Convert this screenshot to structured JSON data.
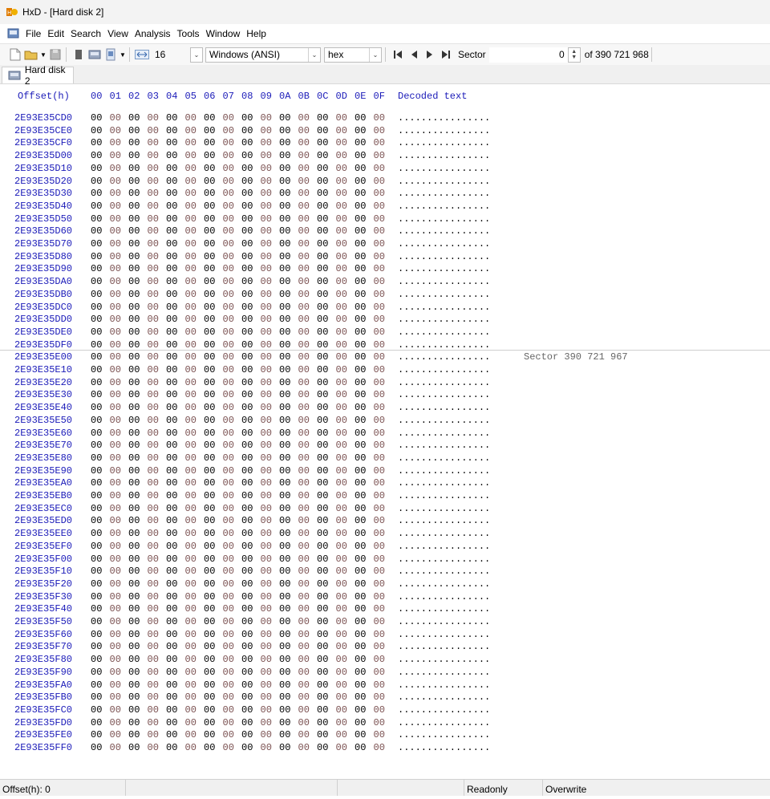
{
  "window": {
    "title": "HxD - [Hard disk 2]"
  },
  "menu": [
    "File",
    "Edit",
    "Search",
    "View",
    "Analysis",
    "Tools",
    "Window",
    "Help"
  ],
  "toolbar": {
    "bytes_per_row": "16",
    "charset": "Windows (ANSI)",
    "offset_base": "hex",
    "nav_unit": "Sector",
    "sector_value": "0",
    "sector_total": "of 390 721 968"
  },
  "tab": {
    "label": "Hard disk 2"
  },
  "editor": {
    "offset_header": "Offset(h)",
    "columns": [
      "00",
      "01",
      "02",
      "03",
      "04",
      "05",
      "06",
      "07",
      "08",
      "09",
      "0A",
      "0B",
      "0C",
      "0D",
      "0E",
      "0F"
    ],
    "decoded_header": "Decoded text",
    "rows": [
      {
        "offset": "2E93E35CD0",
        "bytes": "00 00 00 00 00 00 00 00 00 00 00 00 00 00 00 00",
        "text": "................"
      },
      {
        "offset": "2E93E35CE0",
        "bytes": "00 00 00 00 00 00 00 00 00 00 00 00 00 00 00 00",
        "text": "................"
      },
      {
        "offset": "2E93E35CF0",
        "bytes": "00 00 00 00 00 00 00 00 00 00 00 00 00 00 00 00",
        "text": "................"
      },
      {
        "offset": "2E93E35D00",
        "bytes": "00 00 00 00 00 00 00 00 00 00 00 00 00 00 00 00",
        "text": "................"
      },
      {
        "offset": "2E93E35D10",
        "bytes": "00 00 00 00 00 00 00 00 00 00 00 00 00 00 00 00",
        "text": "................"
      },
      {
        "offset": "2E93E35D20",
        "bytes": "00 00 00 00 00 00 00 00 00 00 00 00 00 00 00 00",
        "text": "................"
      },
      {
        "offset": "2E93E35D30",
        "bytes": "00 00 00 00 00 00 00 00 00 00 00 00 00 00 00 00",
        "text": "................"
      },
      {
        "offset": "2E93E35D40",
        "bytes": "00 00 00 00 00 00 00 00 00 00 00 00 00 00 00 00",
        "text": "................"
      },
      {
        "offset": "2E93E35D50",
        "bytes": "00 00 00 00 00 00 00 00 00 00 00 00 00 00 00 00",
        "text": "................"
      },
      {
        "offset": "2E93E35D60",
        "bytes": "00 00 00 00 00 00 00 00 00 00 00 00 00 00 00 00",
        "text": "................"
      },
      {
        "offset": "2E93E35D70",
        "bytes": "00 00 00 00 00 00 00 00 00 00 00 00 00 00 00 00",
        "text": "................"
      },
      {
        "offset": "2E93E35D80",
        "bytes": "00 00 00 00 00 00 00 00 00 00 00 00 00 00 00 00",
        "text": "................"
      },
      {
        "offset": "2E93E35D90",
        "bytes": "00 00 00 00 00 00 00 00 00 00 00 00 00 00 00 00",
        "text": "................"
      },
      {
        "offset": "2E93E35DA0",
        "bytes": "00 00 00 00 00 00 00 00 00 00 00 00 00 00 00 00",
        "text": "................"
      },
      {
        "offset": "2E93E35DB0",
        "bytes": "00 00 00 00 00 00 00 00 00 00 00 00 00 00 00 00",
        "text": "................"
      },
      {
        "offset": "2E93E35DC0",
        "bytes": "00 00 00 00 00 00 00 00 00 00 00 00 00 00 00 00",
        "text": "................"
      },
      {
        "offset": "2E93E35DD0",
        "bytes": "00 00 00 00 00 00 00 00 00 00 00 00 00 00 00 00",
        "text": "................"
      },
      {
        "offset": "2E93E35DE0",
        "bytes": "00 00 00 00 00 00 00 00 00 00 00 00 00 00 00 00",
        "text": "................"
      },
      {
        "offset": "2E93E35DF0",
        "bytes": "00 00 00 00 00 00 00 00 00 00 00 00 00 00 00 00",
        "text": "................"
      },
      {
        "offset": "2E93E35E00",
        "bytes": "00 00 00 00 00 00 00 00 00 00 00 00 00 00 00 00",
        "text": "................",
        "sector": "Sector 390 721 967"
      },
      {
        "offset": "2E93E35E10",
        "bytes": "00 00 00 00 00 00 00 00 00 00 00 00 00 00 00 00",
        "text": "................"
      },
      {
        "offset": "2E93E35E20",
        "bytes": "00 00 00 00 00 00 00 00 00 00 00 00 00 00 00 00",
        "text": "................"
      },
      {
        "offset": "2E93E35E30",
        "bytes": "00 00 00 00 00 00 00 00 00 00 00 00 00 00 00 00",
        "text": "................"
      },
      {
        "offset": "2E93E35E40",
        "bytes": "00 00 00 00 00 00 00 00 00 00 00 00 00 00 00 00",
        "text": "................"
      },
      {
        "offset": "2E93E35E50",
        "bytes": "00 00 00 00 00 00 00 00 00 00 00 00 00 00 00 00",
        "text": "................"
      },
      {
        "offset": "2E93E35E60",
        "bytes": "00 00 00 00 00 00 00 00 00 00 00 00 00 00 00 00",
        "text": "................"
      },
      {
        "offset": "2E93E35E70",
        "bytes": "00 00 00 00 00 00 00 00 00 00 00 00 00 00 00 00",
        "text": "................"
      },
      {
        "offset": "2E93E35E80",
        "bytes": "00 00 00 00 00 00 00 00 00 00 00 00 00 00 00 00",
        "text": "................"
      },
      {
        "offset": "2E93E35E90",
        "bytes": "00 00 00 00 00 00 00 00 00 00 00 00 00 00 00 00",
        "text": "................"
      },
      {
        "offset": "2E93E35EA0",
        "bytes": "00 00 00 00 00 00 00 00 00 00 00 00 00 00 00 00",
        "text": "................"
      },
      {
        "offset": "2E93E35EB0",
        "bytes": "00 00 00 00 00 00 00 00 00 00 00 00 00 00 00 00",
        "text": "................"
      },
      {
        "offset": "2E93E35EC0",
        "bytes": "00 00 00 00 00 00 00 00 00 00 00 00 00 00 00 00",
        "text": "................"
      },
      {
        "offset": "2E93E35ED0",
        "bytes": "00 00 00 00 00 00 00 00 00 00 00 00 00 00 00 00",
        "text": "................"
      },
      {
        "offset": "2E93E35EE0",
        "bytes": "00 00 00 00 00 00 00 00 00 00 00 00 00 00 00 00",
        "text": "................"
      },
      {
        "offset": "2E93E35EF0",
        "bytes": "00 00 00 00 00 00 00 00 00 00 00 00 00 00 00 00",
        "text": "................"
      },
      {
        "offset": "2E93E35F00",
        "bytes": "00 00 00 00 00 00 00 00 00 00 00 00 00 00 00 00",
        "text": "................"
      },
      {
        "offset": "2E93E35F10",
        "bytes": "00 00 00 00 00 00 00 00 00 00 00 00 00 00 00 00",
        "text": "................"
      },
      {
        "offset": "2E93E35F20",
        "bytes": "00 00 00 00 00 00 00 00 00 00 00 00 00 00 00 00",
        "text": "................"
      },
      {
        "offset": "2E93E35F30",
        "bytes": "00 00 00 00 00 00 00 00 00 00 00 00 00 00 00 00",
        "text": "................"
      },
      {
        "offset": "2E93E35F40",
        "bytes": "00 00 00 00 00 00 00 00 00 00 00 00 00 00 00 00",
        "text": "................"
      },
      {
        "offset": "2E93E35F50",
        "bytes": "00 00 00 00 00 00 00 00 00 00 00 00 00 00 00 00",
        "text": "................"
      },
      {
        "offset": "2E93E35F60",
        "bytes": "00 00 00 00 00 00 00 00 00 00 00 00 00 00 00 00",
        "text": "................"
      },
      {
        "offset": "2E93E35F70",
        "bytes": "00 00 00 00 00 00 00 00 00 00 00 00 00 00 00 00",
        "text": "................"
      },
      {
        "offset": "2E93E35F80",
        "bytes": "00 00 00 00 00 00 00 00 00 00 00 00 00 00 00 00",
        "text": "................"
      },
      {
        "offset": "2E93E35F90",
        "bytes": "00 00 00 00 00 00 00 00 00 00 00 00 00 00 00 00",
        "text": "................"
      },
      {
        "offset": "2E93E35FA0",
        "bytes": "00 00 00 00 00 00 00 00 00 00 00 00 00 00 00 00",
        "text": "................"
      },
      {
        "offset": "2E93E35FB0",
        "bytes": "00 00 00 00 00 00 00 00 00 00 00 00 00 00 00 00",
        "text": "................"
      },
      {
        "offset": "2E93E35FC0",
        "bytes": "00 00 00 00 00 00 00 00 00 00 00 00 00 00 00 00",
        "text": "................"
      },
      {
        "offset": "2E93E35FD0",
        "bytes": "00 00 00 00 00 00 00 00 00 00 00 00 00 00 00 00",
        "text": "................"
      },
      {
        "offset": "2E93E35FE0",
        "bytes": "00 00 00 00 00 00 00 00 00 00 00 00 00 00 00 00",
        "text": "................"
      },
      {
        "offset": "2E93E35FF0",
        "bytes": "00 00 00 00 00 00 00 00 00 00 00 00 00 00 00 00",
        "text": "................"
      }
    ]
  },
  "status": {
    "offset": "Offset(h): 0",
    "mode": "Readonly",
    "insert": "Overwrite"
  },
  "colors": {
    "offset_blue": "#1a1ab8",
    "odd_byte": "#7a5050",
    "even_byte": "#000000"
  }
}
